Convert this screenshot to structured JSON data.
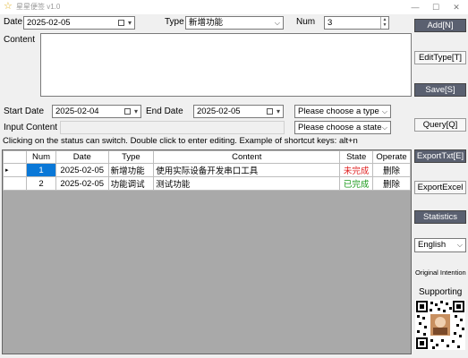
{
  "window": {
    "title": "星星便签 v1.0",
    "minimize": "—",
    "maximize": "☐",
    "close": "✕"
  },
  "form": {
    "date_label": "Date",
    "date_value": "2025-02-05",
    "type_label": "Type",
    "type_value": "新增功能",
    "num_label": "Num",
    "num_value": "3",
    "content_label": "Content",
    "content_value": ""
  },
  "filters": {
    "start_label": "Start Date",
    "start_value": "2025-02-04",
    "end_label": "End Date",
    "end_value": "2025-02-05",
    "type_placeholder": "Please choose a type",
    "input_label": "Input Content",
    "input_value": "",
    "state_placeholder": "Please choose a state",
    "hint": "Clicking on the status can switch. Double click to enter editing. Example of shortcut keys: alt+n"
  },
  "buttons": {
    "add": "Add[N]",
    "edit_type": "EditType[T]",
    "save": "Save[S]",
    "query": "Query[Q]",
    "export_txt": "ExportTxt[E]",
    "export_excel": "ExportExcel",
    "statistics": "Statistics",
    "language": "English",
    "original_intention": "Original Intention",
    "supporting": "Supporting"
  },
  "table": {
    "headers": [
      "Num",
      "Date",
      "Type",
      "Content",
      "State",
      "Operate"
    ],
    "rows": [
      {
        "selector": "▸",
        "num": "1",
        "date": "2025-02-05",
        "type": "新增功能",
        "content": "使用实际设备开发串口工具",
        "state": "未完成",
        "operate": "删除"
      },
      {
        "selector": "",
        "num": "2",
        "date": "2025-02-05",
        "type": "功能调试",
        "content": "测试功能",
        "state": "已完成",
        "operate": "删除"
      }
    ]
  },
  "colors": {
    "state_incomplete": "#e02020",
    "state_complete": "#1a9a1a",
    "dark_button": "#5a6070",
    "selection": "#0a78d7"
  }
}
